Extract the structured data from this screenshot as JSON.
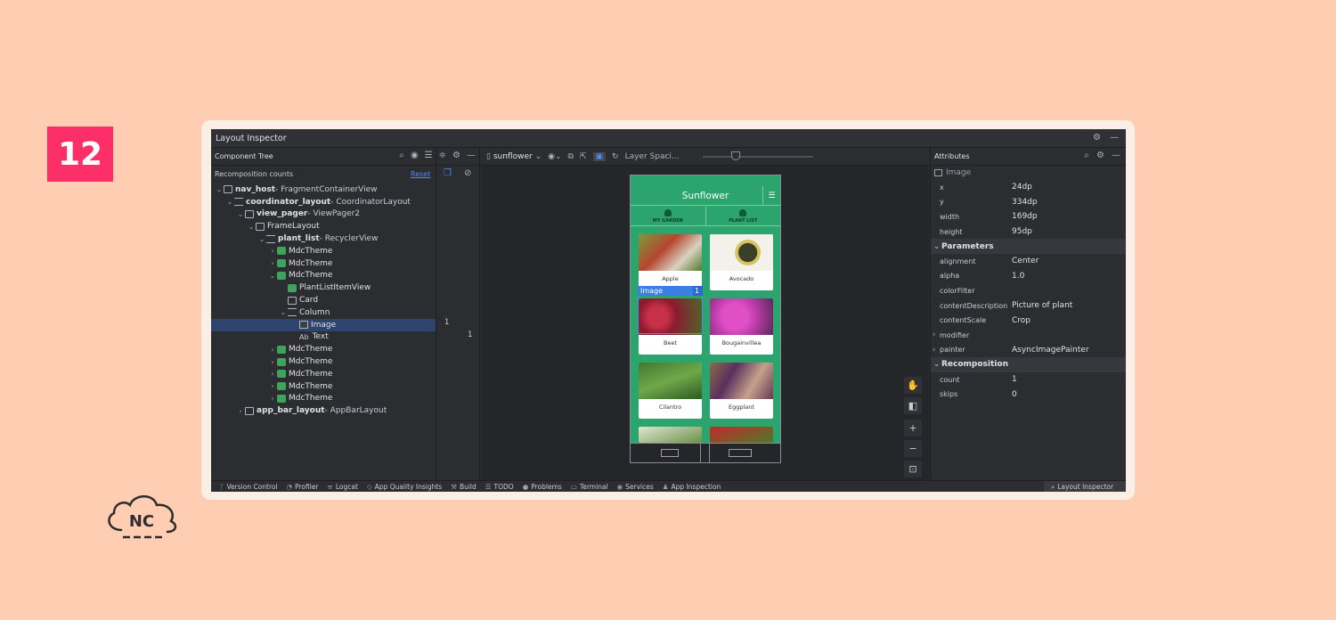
{
  "badge": "12",
  "logo_text": "NC",
  "window": {
    "title": "Layout Inspector"
  },
  "component_tree": {
    "header": "Component Tree",
    "sub_label": "Recomposition counts",
    "reset": "Reset",
    "rows": [
      {
        "name": "nav_host",
        "type": " - FragmentContainerView"
      },
      {
        "name": "coordinator_layout",
        "type": " - CoordinatorLayout"
      },
      {
        "name": "view_pager",
        "type": " - ViewPager2"
      },
      {
        "name": "FrameLayout",
        "type": ""
      },
      {
        "name": "plant_list",
        "type": " - RecyclerView"
      },
      {
        "name": "MdcTheme",
        "type": ""
      },
      {
        "name": "MdcTheme",
        "type": ""
      },
      {
        "name": "MdcTheme",
        "type": ""
      },
      {
        "name": "PlantListItemView",
        "type": ""
      },
      {
        "name": "Card",
        "type": ""
      },
      {
        "name": "Column",
        "type": ""
      },
      {
        "name": "Image",
        "type": ""
      },
      {
        "name": "Text",
        "type": ""
      },
      {
        "name": "MdcTheme",
        "type": ""
      },
      {
        "name": "MdcTheme",
        "type": ""
      },
      {
        "name": "MdcTheme",
        "type": ""
      },
      {
        "name": "MdcTheme",
        "type": ""
      },
      {
        "name": "MdcTheme",
        "type": ""
      },
      {
        "name": "app_bar_layout",
        "type": " - AppBarLayout"
      }
    ],
    "image_count": "1",
    "text_count": "1",
    "text_prefix": "Ab"
  },
  "toolbar": {
    "device": "sunflower",
    "layer_spacing": "Layer Spaci..."
  },
  "phone": {
    "title": "Sunflower",
    "tab1": "MY GARDEN",
    "tab2": "PLANT LIST",
    "highlight_label": "Image",
    "highlight_count": "1",
    "cards": [
      "Apple",
      "Avocado",
      "Beet",
      "Bougainvillea",
      "Cilantro",
      "Eggplant"
    ]
  },
  "attributes": {
    "header": "Attributes",
    "selected": "Image",
    "base": [
      {
        "k": "x",
        "v": "24dp"
      },
      {
        "k": "y",
        "v": "334dp"
      },
      {
        "k": "width",
        "v": "169dp"
      },
      {
        "k": "height",
        "v": "95dp"
      }
    ],
    "parameters_title": "Parameters",
    "parameters": [
      {
        "k": "alignment",
        "v": "Center"
      },
      {
        "k": "alpha",
        "v": "1.0"
      },
      {
        "k": "colorFilter",
        "v": ""
      },
      {
        "k": "contentDescription",
        "v": "Picture of plant"
      },
      {
        "k": "contentScale",
        "v": "Crop"
      },
      {
        "k": "modifier",
        "v": ""
      },
      {
        "k": "painter",
        "v": "AsyncImagePainter"
      }
    ],
    "recomposition_title": "Recomposition",
    "recomposition": [
      {
        "k": "count",
        "v": "1"
      },
      {
        "k": "skips",
        "v": "0"
      }
    ]
  },
  "statusbar": [
    "Version Control",
    "Profiler",
    "Logcat",
    "App Quality Insights",
    "Build",
    "TODO",
    "Problems",
    "Terminal",
    "Services",
    "App Inspection"
  ],
  "statusbar_active": "Layout Inspector"
}
